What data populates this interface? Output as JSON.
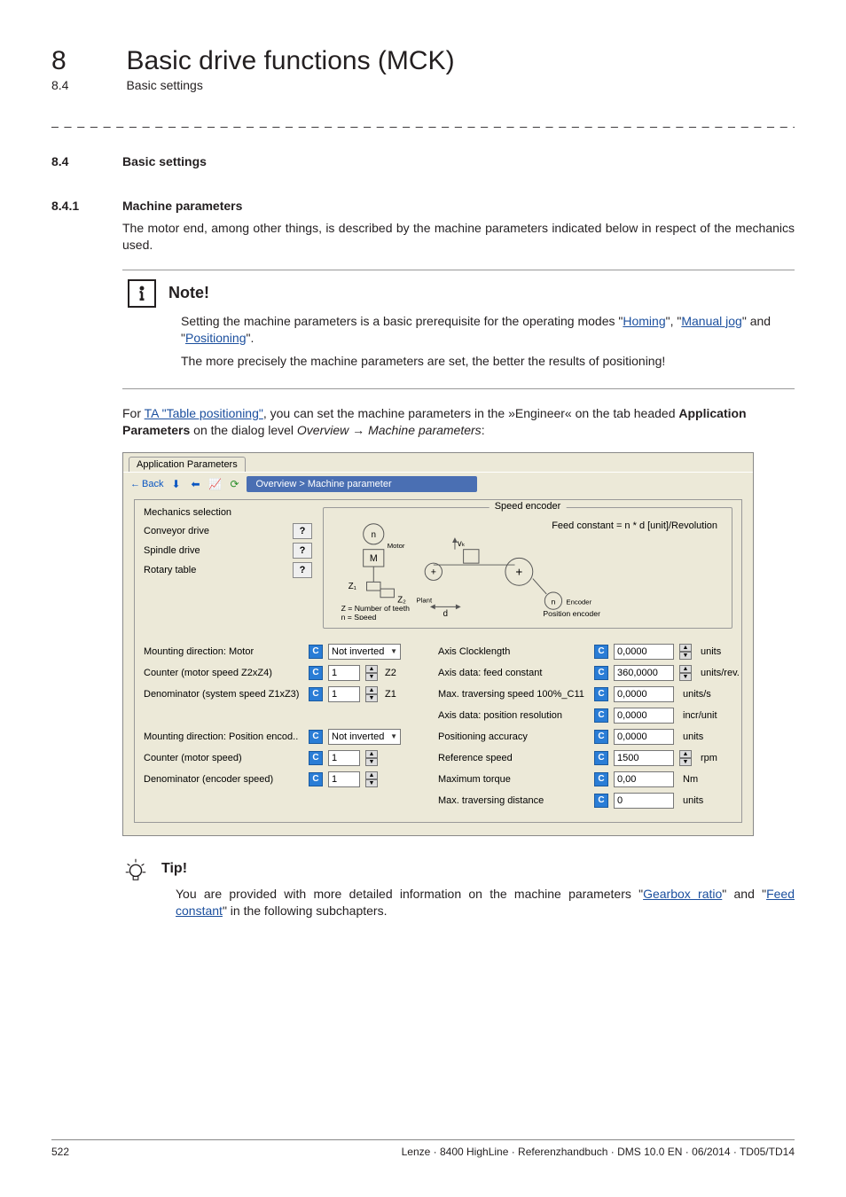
{
  "header": {
    "chapter_num": "8",
    "chapter_title": "Basic drive functions (MCK)",
    "sub_num": "8.4",
    "sub_title": "Basic settings"
  },
  "h84": {
    "num": "8.4",
    "title": "Basic settings"
  },
  "h841": {
    "num": "8.4.1",
    "title": "Machine parameters"
  },
  "intro_para": "The motor end, among other things, is described by the machine parameters indicated below in respect of the mechanics used.",
  "note": {
    "label": "Note!",
    "line1_pre": "Setting the machine parameters is a basic prerequisite for the operating modes \"",
    "homing": "Homing",
    "line1_mid1": "\", \"",
    "manualjog": "Manual jog",
    "line1_mid2": "\" and \"",
    "positioning": "Positioning",
    "line1_post": "\".",
    "line2": "The more precisely the machine parameters are set, the better the results of positioning!"
  },
  "brtext": {
    "pre": "For ",
    "ta_link": "TA \"Table positioning\"",
    "mid": ", you can set the machine parameters in the »Engineer« on the tab headed ",
    "bold": "Application Parameters",
    "mid2": " on the dialog level ",
    "italic1": "Overview",
    "arrow": " → ",
    "italic2": "Machine parameters",
    "post": ":"
  },
  "screenshot": {
    "tab": "Application Parameters",
    "back": "Back",
    "breadcrumb": "Overview > Machine parameter",
    "mech_title": "Mechanics selection",
    "mech_items": [
      "Conveyor drive",
      "Spindle drive",
      "Rotary table"
    ],
    "speed_legend": "Speed encoder",
    "feed_formula": "Feed constant = n * d [unit]/Revolution",
    "diag_n_motor": "n",
    "diag_motor_sub": "Motor",
    "diag_z1": "Z₁",
    "diag_z2": "Z₂",
    "diag_vk": "vₖ",
    "diag_n_plant": "n",
    "diag_plant_sub": "Plant",
    "diag_n_enc": "n",
    "diag_enc_sub": "Encoder",
    "diag_d": "d",
    "diag_z_note": "Z = Number of teeth",
    "diag_n_note": "n = Speed",
    "diag_m": "M",
    "diag_pos_enc": "Position encoder",
    "left_params": [
      {
        "label": "Mounting direction: Motor",
        "type": "drop",
        "value": "Not inverted"
      },
      {
        "label": "Counter (motor speed Z2xZ4)",
        "type": "spin",
        "value": "1",
        "suffix": "Z2"
      },
      {
        "label": "Denominator (system speed Z1xZ3)",
        "type": "spin",
        "value": "1",
        "suffix": "Z1"
      },
      {
        "label": "Mounting direction: Position encod..",
        "type": "drop",
        "value": "Not inverted",
        "spacer_before": true
      },
      {
        "label": "Counter (motor speed)",
        "type": "spin",
        "value": "1"
      },
      {
        "label": "Denominator (encoder speed)",
        "type": "spin",
        "value": "1"
      }
    ],
    "right_params": [
      {
        "label": "Axis Clocklength",
        "value": "0,0000",
        "unit": "units",
        "stepper": true
      },
      {
        "label": "Axis data: feed constant",
        "value": "360,0000",
        "unit": "units/rev.",
        "stepper": true
      },
      {
        "label": "Max. traversing speed 100%_C11",
        "value": "0,0000",
        "unit": "units/s"
      },
      {
        "label": "Axis data: position resolution",
        "value": "0,0000",
        "unit": "incr/unit"
      },
      {
        "label": "Positioning accuracy",
        "value": "0,0000",
        "unit": "units"
      },
      {
        "label": "Reference speed",
        "value": "1500",
        "unit": "rpm",
        "stepper": true
      },
      {
        "label": "Maximum torque",
        "value": "0,00",
        "unit": "Nm"
      },
      {
        "label": "Max. traversing distance",
        "value": "0",
        "unit": "units"
      }
    ]
  },
  "tip": {
    "label": "Tip!",
    "pre": "You are provided with more detailed information on the machine parameters \"",
    "gearbox": "Gearbox ratio",
    "mid": "\" and \"",
    "feed": "Feed constant",
    "post": "\" in the following subchapters."
  },
  "footer": {
    "page": "522",
    "credit": "Lenze · 8400 HighLine · Referenzhandbuch · DMS 10.0 EN · 06/2014 · TD05/TD14"
  },
  "chart_data": {
    "type": "table",
    "title": "Machine parameter dialog values",
    "series": [
      {
        "name": "Axis Clocklength",
        "values": [
          "0,0000",
          "units"
        ]
      },
      {
        "name": "Axis data: feed constant",
        "values": [
          "360,0000",
          "units/rev."
        ]
      },
      {
        "name": "Max. traversing speed 100%_C11",
        "values": [
          "0,0000",
          "units/s"
        ]
      },
      {
        "name": "Axis data: position resolution",
        "values": [
          "0,0000",
          "incr/unit"
        ]
      },
      {
        "name": "Positioning accuracy",
        "values": [
          "0,0000",
          "units"
        ]
      },
      {
        "name": "Reference speed",
        "values": [
          "1500",
          "rpm"
        ]
      },
      {
        "name": "Maximum torque",
        "values": [
          "0,00",
          "Nm"
        ]
      },
      {
        "name": "Max. traversing distance",
        "values": [
          "0",
          "units"
        ]
      },
      {
        "name": "Mounting direction: Motor",
        "values": [
          "Not inverted"
        ]
      },
      {
        "name": "Counter (motor speed Z2xZ4)",
        "values": [
          "1",
          "Z2"
        ]
      },
      {
        "name": "Denominator (system speed Z1xZ3)",
        "values": [
          "1",
          "Z1"
        ]
      },
      {
        "name": "Mounting direction: Position encod..",
        "values": [
          "Not inverted"
        ]
      },
      {
        "name": "Counter (motor speed)",
        "values": [
          "1"
        ]
      },
      {
        "name": "Denominator (encoder speed)",
        "values": [
          "1"
        ]
      }
    ]
  }
}
